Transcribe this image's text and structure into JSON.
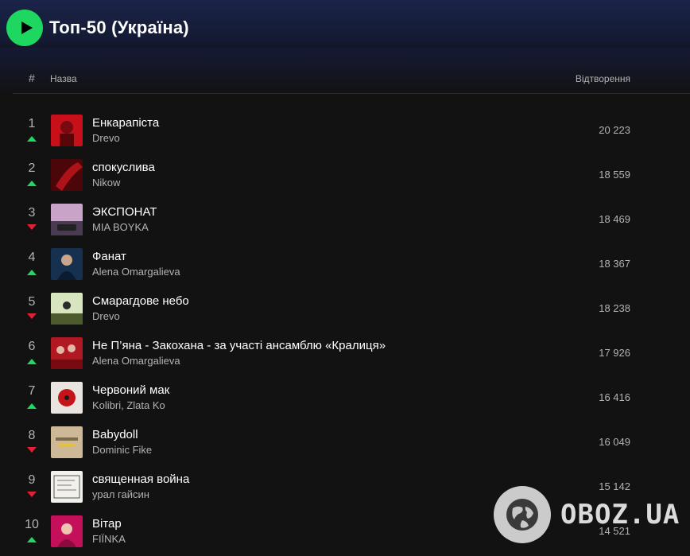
{
  "playlist": {
    "title": "Топ-50 (Україна)"
  },
  "columns": {
    "index": "#",
    "name": "Назва",
    "plays": "Відтворення"
  },
  "colors": {
    "accent": "#1ed760",
    "trend_up": "#1ed760",
    "trend_down": "#e22134"
  },
  "tracks": [
    {
      "rank": "1",
      "title": "Енкарапіста",
      "artist": "Drevo",
      "plays": "20 223",
      "trend": "up",
      "cover_icon": "cover-red-portrait"
    },
    {
      "rank": "2",
      "title": "спокуслива",
      "artist": "Nikow",
      "plays": "18 559",
      "trend": "up",
      "cover_icon": "cover-dark-red"
    },
    {
      "rank": "3",
      "title": "ЭКСПОНАТ",
      "artist": "MIA BOYKA",
      "plays": "18 469",
      "trend": "down",
      "cover_icon": "cover-pink-car"
    },
    {
      "rank": "4",
      "title": "Фанат",
      "artist": "Alena Omargalieva",
      "plays": "18 367",
      "trend": "up",
      "cover_icon": "cover-blue-portrait"
    },
    {
      "rank": "5",
      "title": "Смарагдове небо",
      "artist": "Drevo",
      "plays": "18 238",
      "trend": "down",
      "cover_icon": "cover-green-sky"
    },
    {
      "rank": "6",
      "title": "Не П’яна - Закохана - за участі ансамблю «Кралиця»",
      "artist": "Alena Omargalieva",
      "plays": "17 926",
      "trend": "up",
      "cover_icon": "cover-red-group"
    },
    {
      "rank": "7",
      "title": "Червоний мак",
      "artist": "Kolibri, Zlata Ko",
      "plays": "16 416",
      "trend": "up",
      "cover_icon": "cover-poppy"
    },
    {
      "rank": "8",
      "title": "Babydoll",
      "artist": "Dominic Fike",
      "plays": "16 049",
      "trend": "down",
      "cover_icon": "cover-beige-stripes"
    },
    {
      "rank": "9",
      "title": "священная война",
      "artist": "урал гайсин",
      "plays": "15 142",
      "trend": "down",
      "cover_icon": "cover-comic-sketch"
    },
    {
      "rank": "10",
      "title": "Вітар",
      "artist": "FIЇNKA",
      "plays": "14 521",
      "trend": "up",
      "cover_icon": "cover-pink-portrait"
    }
  ],
  "watermark": {
    "text": "OBOZ.UA",
    "icon": "globe-icon"
  }
}
